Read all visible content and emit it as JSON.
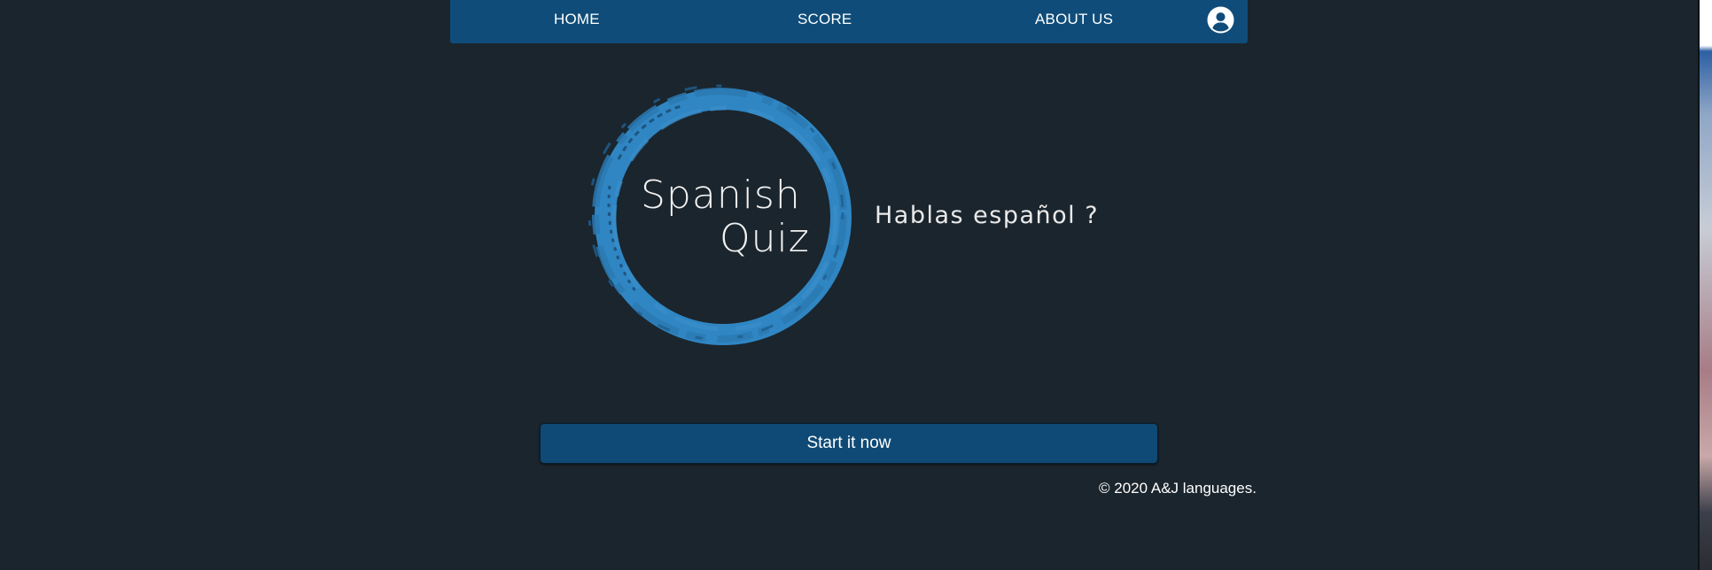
{
  "nav": {
    "home_label": "HOME",
    "score_label": "SCORE",
    "about_label": "ABOUT US",
    "user_icon": "user-circle-icon"
  },
  "logo": {
    "line1": "Spanish",
    "line2": "Quiz",
    "ring_color": "#2f86c3"
  },
  "hero": {
    "tagline": "Hablas español ?"
  },
  "cta": {
    "start_label": "Start it now"
  },
  "footer": {
    "copyright": "© 2020 A&J languages."
  },
  "colors": {
    "background": "#1b252d",
    "navbar": "#0f4c79",
    "button": "#0f4a76"
  }
}
